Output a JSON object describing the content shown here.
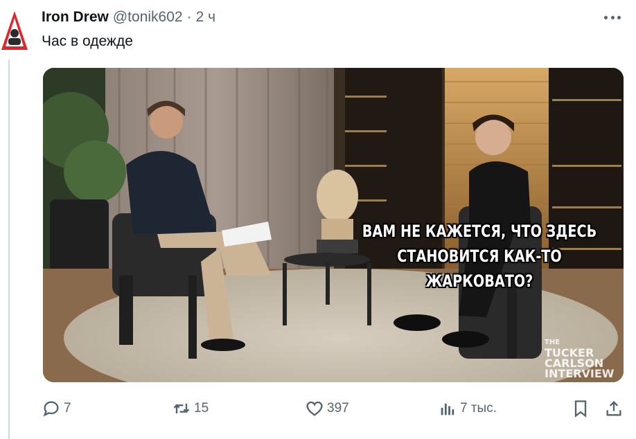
{
  "tweet": {
    "author": {
      "display_name": "Iron Drew",
      "handle": "@tonik602",
      "separator": "·",
      "time": "2 ч"
    },
    "text": "Час в одежде",
    "media": {
      "subtitle_lines": [
        "ВАМ НЕ КАЖЕТСЯ, ЧТО ЗДЕСЬ",
        "СТАНОВИТСЯ КАК-ТО",
        "ЖАРКОВАТО?"
      ],
      "watermark_lines": [
        "THE",
        "TUCKER",
        "CARLSON",
        "INTERVIEW"
      ]
    },
    "actions": {
      "replies": "7",
      "reposts": "15",
      "likes": "397",
      "views": "7 тыс."
    }
  },
  "icons": {
    "avatar": "warning-triangle-avatar",
    "more": "more-dots-icon",
    "reply": "reply-icon",
    "repost": "repost-icon",
    "like": "heart-icon",
    "views": "views-bar-icon",
    "bookmark": "bookmark-icon",
    "share": "share-icon"
  },
  "colors": {
    "text_primary": "#0f1419",
    "text_secondary": "#536471",
    "avatar_red": "#e0262b"
  }
}
